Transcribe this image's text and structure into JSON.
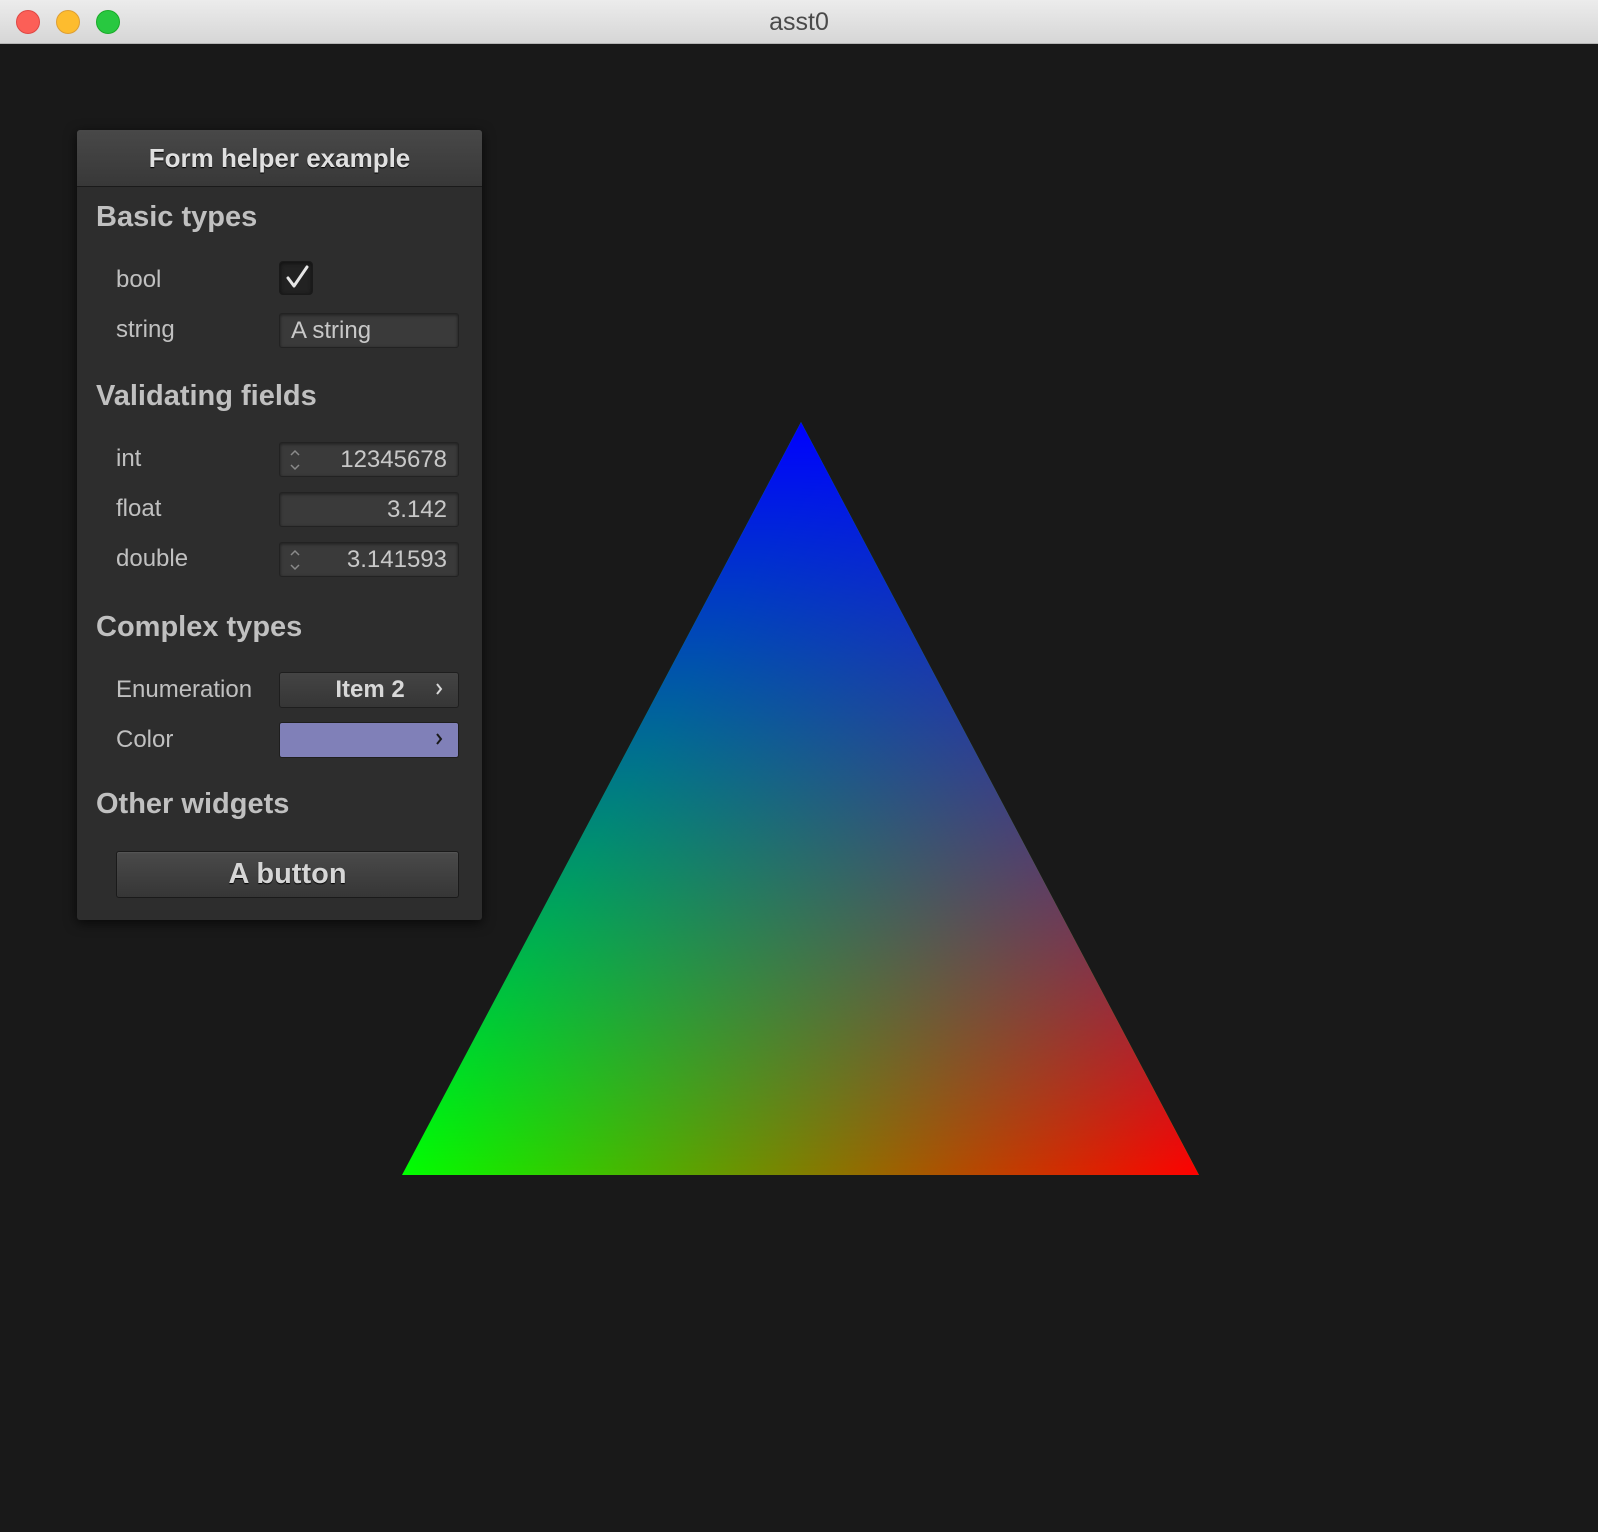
{
  "window": {
    "title": "asst0"
  },
  "panel": {
    "title": "Form helper example",
    "groups": {
      "basic": "Basic types",
      "validating": "Validating fields",
      "complex": "Complex types",
      "other": "Other widgets"
    },
    "fields": {
      "bool": {
        "label": "bool",
        "checked": true
      },
      "string": {
        "label": "string",
        "value": "A string"
      },
      "int": {
        "label": "int",
        "value": "12345678"
      },
      "float": {
        "label": "float",
        "value": "3.142"
      },
      "double": {
        "label": "double",
        "value": "3.141593"
      },
      "enumeration": {
        "label": "Enumeration",
        "value": "Item 2"
      },
      "color": {
        "label": "Color",
        "value": "#8080b8"
      }
    },
    "button_label": "A button"
  },
  "triangle": {
    "top_color": "#0000ff",
    "left_color": "#00ff00",
    "right_color": "#ff0000"
  },
  "colors": {
    "background": "#191919",
    "panel": "#2d2d2d"
  }
}
